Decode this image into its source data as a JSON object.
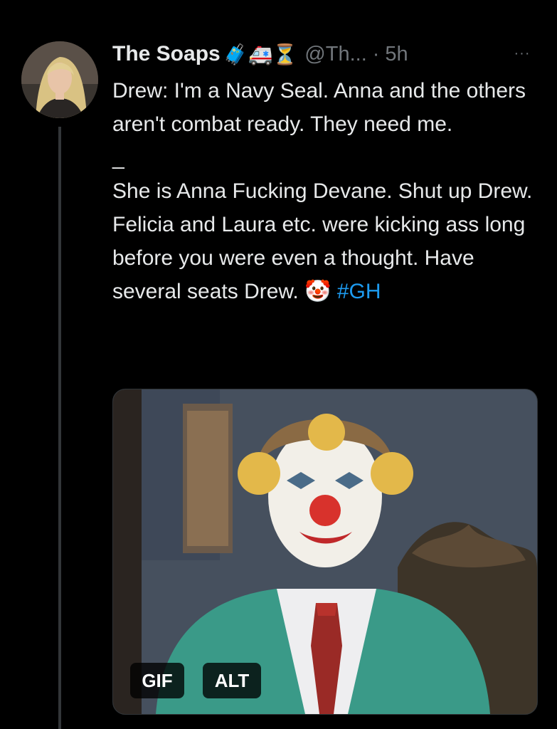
{
  "author": {
    "display_name": "The Soaps",
    "emojis": "🧳🚑⏳",
    "handle": "@Th...",
    "separator": "·",
    "timestamp": "5h",
    "avatar_icon": "user-avatar"
  },
  "menu": {
    "more_label": "···",
    "icon": "more-horizontal-icon"
  },
  "tweet": {
    "paragraphs": [
      "Drew: I'm a Navy Seal. Anna and the others aren't combat ready. They need me.",
      "_",
      "She is Anna Fucking Devane. Shut up Drew. Felicia and Laura etc. were kicking ass long before you were even a thought. Have several seats Drew."
    ],
    "clown_emoji": "🤡",
    "hashtag": "#GH"
  },
  "media": {
    "type": "gif",
    "gif_label": "GIF",
    "alt_label": "ALT"
  },
  "colors": {
    "background": "#000000",
    "text": "#e7e9ea",
    "muted": "#71767b",
    "link": "#1d9bf0"
  }
}
